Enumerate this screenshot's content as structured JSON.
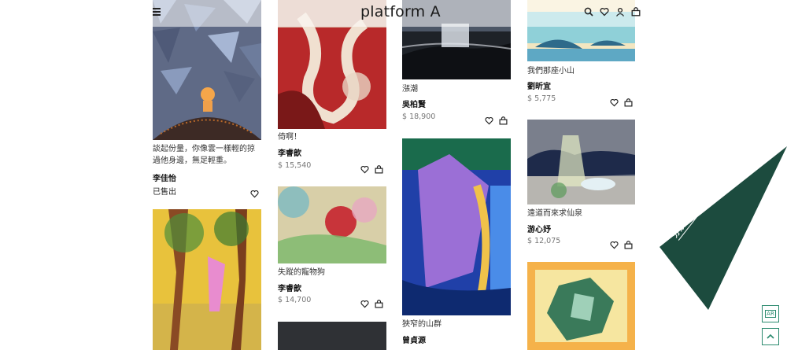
{
  "header": {
    "logo": "platform A",
    "icons": [
      "menu-icon",
      "search-icon",
      "heart-icon",
      "user-icon",
      "cart-icon"
    ]
  },
  "cards": [
    {
      "title": "談起份量，你像雲一樣輕的掠過他身邊，無足輕重。",
      "artist": "李佳怡",
      "status": "已售出"
    },
    {
      "title": "倚啊！",
      "artist": "李睿歆",
      "price": "$ 15,540"
    },
    {
      "title": "失蹤的寵物狗",
      "artist": "李睿歆",
      "price": "$ 14,700"
    },
    {
      "title": "漲潮",
      "artist": "吳柏賢",
      "price": "$ 18,900"
    },
    {
      "title": "狹窄的山群",
      "artist": "曾貞源"
    },
    {
      "title": "我們那座小山",
      "artist": "劉昕宜",
      "price": "$ 5,775"
    },
    {
      "title": "遠道而來求仙泉",
      "artist": "游心妤",
      "price": "$ 12,075"
    }
  ],
  "category_flag": {
    "label": "分類選擇",
    "color": "#1c4b3e"
  },
  "float_buttons": {
    "ar": "AR",
    "top_icon": "chevron-up-icon",
    "accent": "#2a8a6e"
  }
}
